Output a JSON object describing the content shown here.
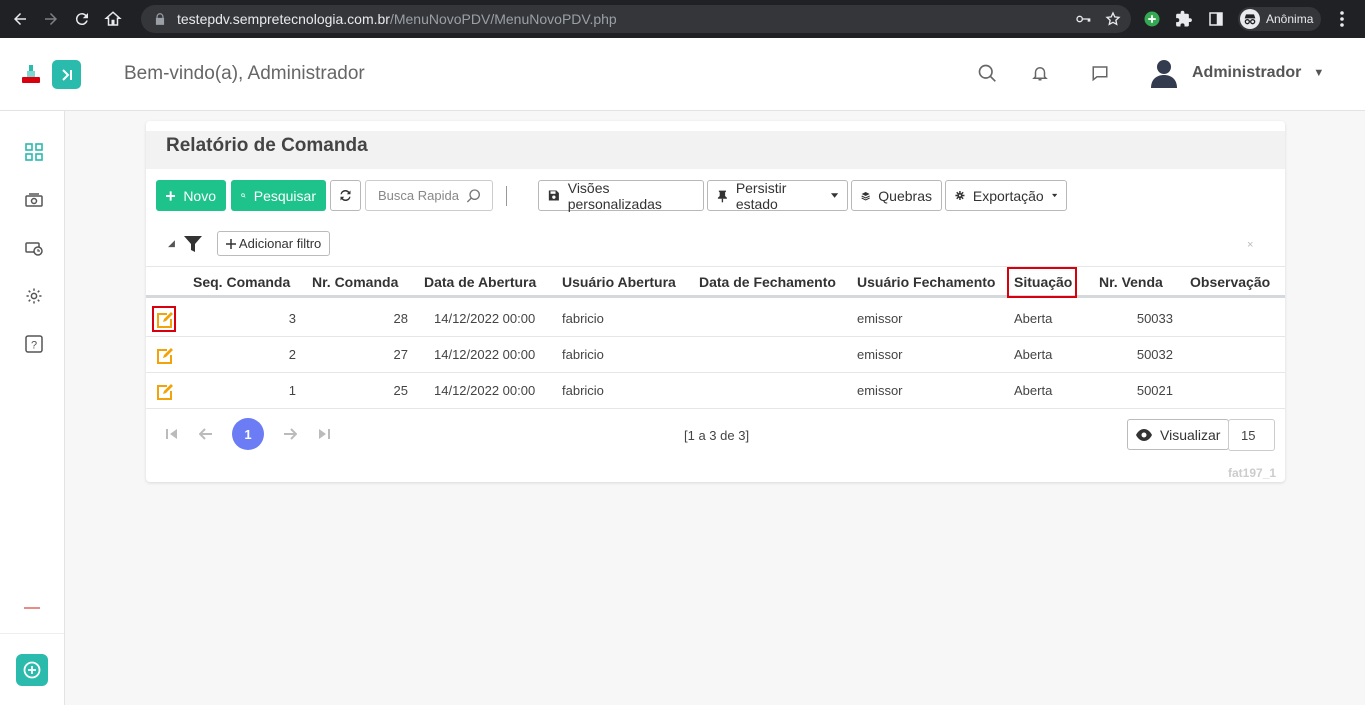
{
  "browser": {
    "url_host": "testepdv.sempretecnologia.com.br",
    "url_path": "/MenuNovoPDV/MenuNovoPDV.php",
    "profile_label": "Anônima"
  },
  "header": {
    "welcome": "Bem-vindo(a), Administrador",
    "user_name": "Administrador",
    "caret": "▼"
  },
  "card": {
    "title": "Relatório de Comanda"
  },
  "toolbar": {
    "novo": "Novo",
    "pesquisar": "Pesquisar",
    "search_placeholder": "Busca Rapida",
    "visoes": "Visões personalizadas",
    "persistir": "Persistir estado",
    "quebras": "Quebras",
    "exportacao": "Exportação"
  },
  "filters": {
    "add_filter": "Adicionar filtro",
    "close": "×"
  },
  "table": {
    "columns": [
      "Seq. Comanda",
      "Nr. Comanda",
      "Data de Abertura",
      "Usuário Abertura",
      "Data de Fechamento",
      "Usuário Fechamento",
      "Situação",
      "Nr. Venda",
      "Observação"
    ],
    "rows": [
      [
        "3",
        "28",
        "14/12/2022 00:00",
        "fabricio",
        "",
        "emissor",
        "Aberta",
        "50033",
        ""
      ],
      [
        "2",
        "27",
        "14/12/2022 00:00",
        "fabricio",
        "",
        "emissor",
        "Aberta",
        "50032",
        ""
      ],
      [
        "1",
        "25",
        "14/12/2022 00:00",
        "fabricio",
        "",
        "emissor",
        "Aberta",
        "50021",
        ""
      ]
    ]
  },
  "pagination": {
    "current_page": "1",
    "info": "[1 a 3 de 3]",
    "visualizar": "Visualizar",
    "page_size": "15"
  },
  "footer": {
    "version": "fat197_1"
  },
  "colors": {
    "accent_teal": "#2bbbad",
    "button_green": "#1ec28b",
    "page_active": "#6b7cf5",
    "highlight_red": "#d9000d",
    "edit_orange": "#f0a30a"
  }
}
